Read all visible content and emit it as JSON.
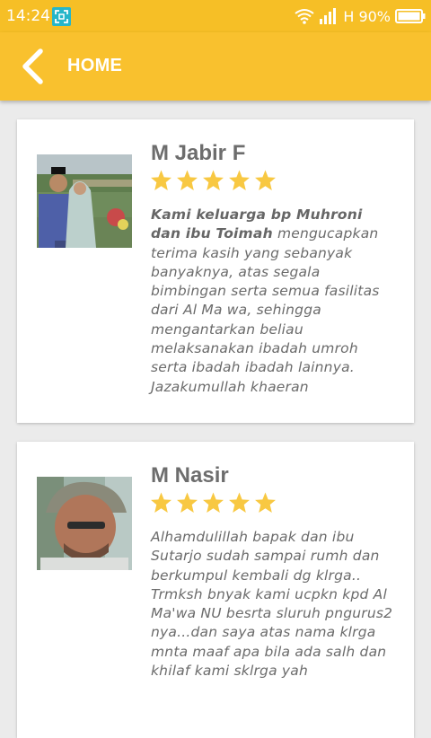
{
  "status_bar": {
    "time": "14:24",
    "network": "H",
    "battery": "90%"
  },
  "app_bar": {
    "title": "HOME",
    "back_icon": "chevron-left-icon"
  },
  "testimonials": [
    {
      "name": "M Jabir F",
      "rating": 5,
      "text_bold": "Kami keluarga bp Muhroni dan ibu Toimah",
      "text": " mengucapkan terima kasih yang sebanyak banyaknya, atas segala bimbingan serta semua fasilitas dari Al Ma wa, sehingga mengantarkan beliau melaksanakan ibadah umroh serta ibadah ibadah lainnya. Jazakumullah khaeran"
    },
    {
      "name": "M Nasir",
      "rating": 5,
      "text_bold": "",
      "text": "Alhamdulillah bapak dan ibu Sutarjo sudah sampai rumh dan berkumpul kembali dg klrga.. Trmksh bnyak kami ucpkn kpd Al Ma'wa NU besrta sluruh pngurus2 nya...dan saya atas nama klrga mnta maaf apa bila ada salh dan khilaf kami sklrga yah"
    }
  ],
  "colors": {
    "status_bar": "#f6bf26",
    "app_bar": "#f9c12e",
    "star": "#f8c842",
    "background": "#ebebeb"
  }
}
